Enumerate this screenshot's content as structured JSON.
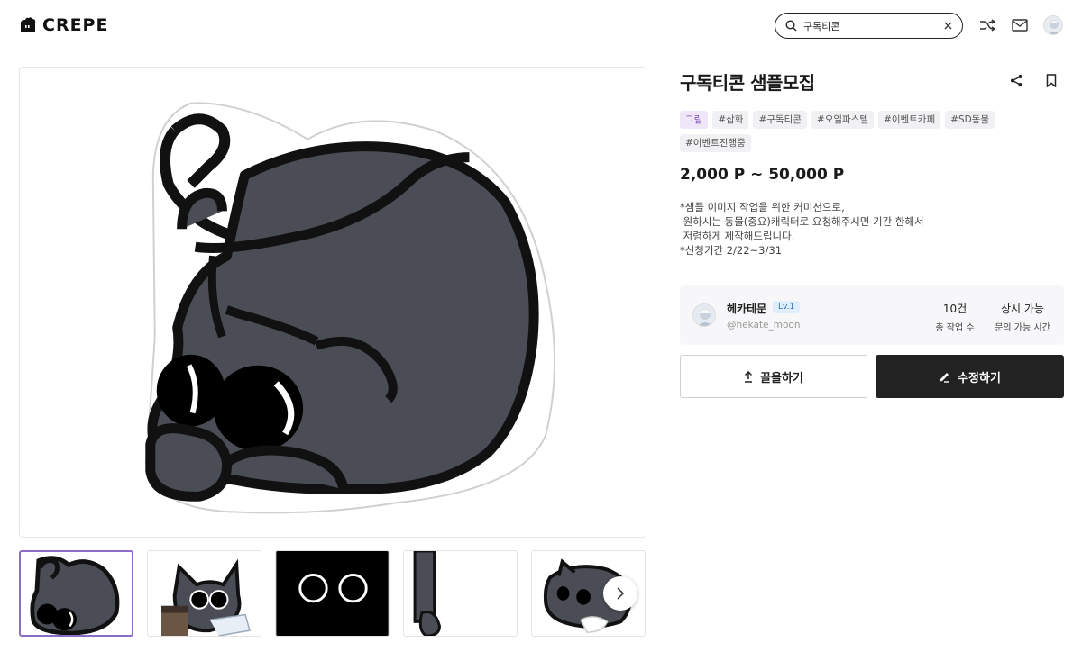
{
  "app": {
    "logo_text": "CREPE"
  },
  "header": {
    "search": {
      "value": "구독티콘",
      "placeholder": ""
    },
    "icons": [
      "search-icon",
      "clear-icon",
      "shuffle-icon",
      "mail-icon",
      "avatar"
    ]
  },
  "listing": {
    "title": "구독티콘 샘플모집",
    "category": "그림",
    "tags": [
      "#삽화",
      "#구독티콘",
      "#오일파스텔",
      "#이벤트카페",
      "#SD동물",
      "#이벤트진행중"
    ],
    "price": "2,000 P ~ 50,000 P",
    "description": [
      "*샘플 이미지 작업을 위한 커미션으로,",
      " 원하시는 동물(중요)캐릭터로 요청해주시면 기간 한해서",
      " 저렴하게 제작해드립니다.",
      "*신청기간 2/22~3/31"
    ]
  },
  "seller": {
    "name": "헤카테문",
    "level": "Lv.1",
    "handle": "@hekate_moon",
    "stats": [
      {
        "value": "10건",
        "label": "총 작업 수"
      },
      {
        "value": "상시 가능",
        "label": "문의 가능 시간"
      }
    ]
  },
  "actions": {
    "bump_label": "끌올하기",
    "edit_label": "수정하기"
  },
  "colors": {
    "accent_purple": "#8b6cc8",
    "category_bg": "#efe6f8",
    "dark_button": "#222222",
    "cat_body": "#4a4d55"
  }
}
